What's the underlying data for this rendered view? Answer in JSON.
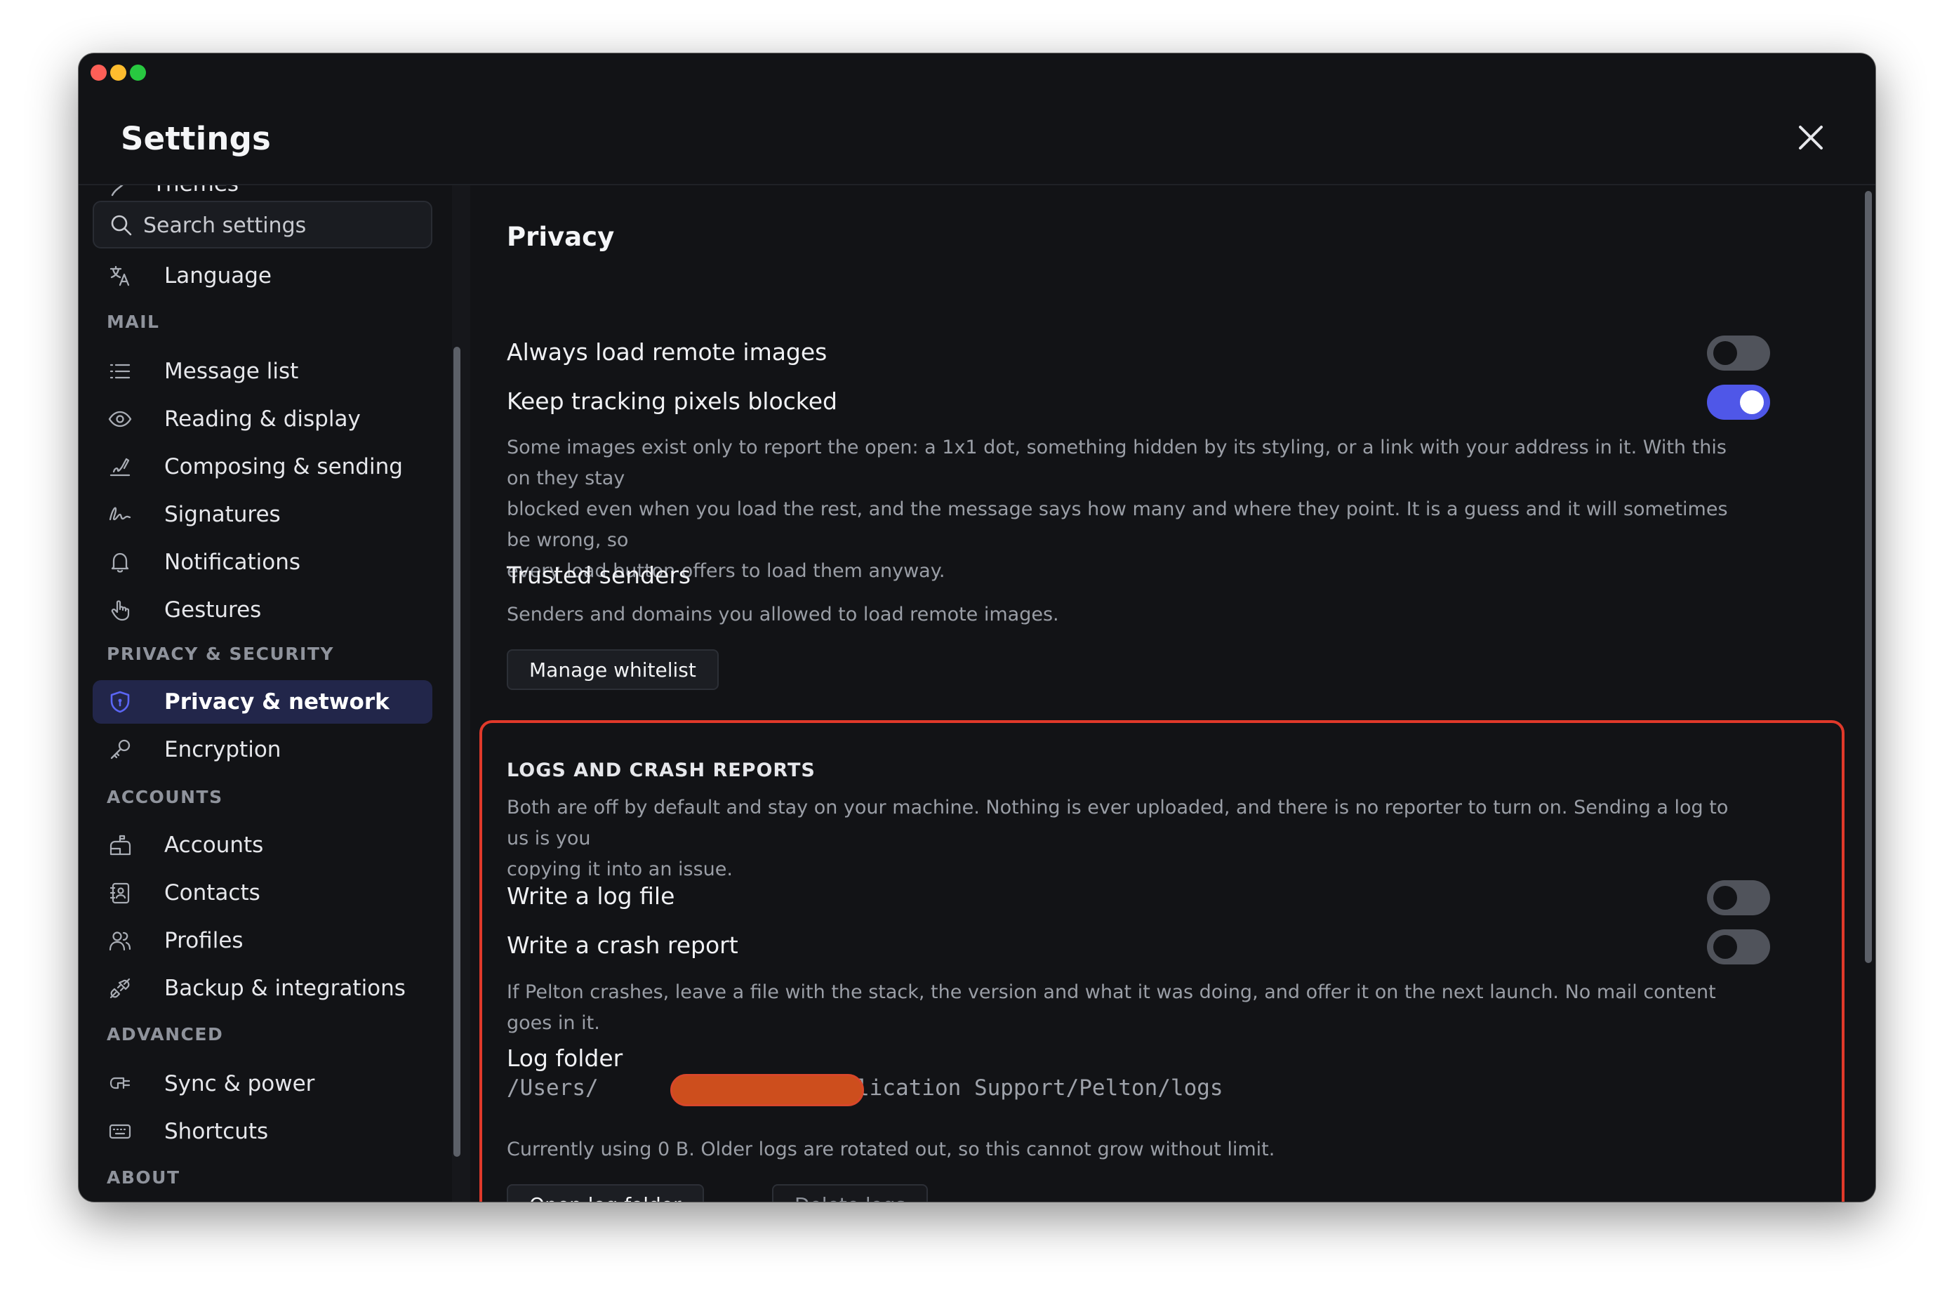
{
  "window": {
    "title": "Settings",
    "close_icon": "close-icon"
  },
  "sidebar": {
    "clipped_item": "Themes",
    "search": {
      "placeholder": "Search settings",
      "value": ""
    },
    "language": "Language",
    "sections": {
      "mail": "MAIL",
      "privacy_security": "PRIVACY & SECURITY",
      "accounts": "ACCOUNTS",
      "advanced": "ADVANCED",
      "about": "ABOUT"
    },
    "items": {
      "message_list": "Message list",
      "reading_display": "Reading & display",
      "composing_sending": "Composing & sending",
      "signatures": "Signatures",
      "notifications": "Notifications",
      "gestures": "Gestures",
      "privacy_network": "Privacy & network",
      "encryption": "Encryption",
      "accounts": "Accounts",
      "contacts": "Contacts",
      "profiles": "Profiles",
      "backup_integrations": "Backup & integrations",
      "sync_power": "Sync & power",
      "shortcuts": "Shortcuts"
    },
    "active_item": "Privacy & network",
    "accent_color": "#4f57e8"
  },
  "privacy": {
    "heading": "Privacy",
    "always_load_remote_images": {
      "label": "Always load remote images",
      "enabled": false
    },
    "keep_tracking_pixels_blocked": {
      "label": "Keep tracking pixels blocked",
      "enabled": true
    },
    "tracking_description_1": "Some images exist only to report the open: a 1x1 dot, something hidden by its styling, or a link with your address in it. With this on they stay",
    "tracking_description_2": "blocked even when you load the rest, and the message says how many and where they point. It is a guess and it will sometimes be wrong, so",
    "tracking_description_3": "every load button offers to load them anyway.",
    "trusted_senders": {
      "label": "Trusted senders",
      "description": "Senders and domains you allowed to load remote images.",
      "button": "Manage whitelist"
    }
  },
  "logs": {
    "heading": "LOGS AND CRASH REPORTS",
    "description_1": "Both are off by default and stay on your machine. Nothing is ever uploaded, and there is no reporter to turn on. Sending a log to us is you",
    "description_2": "copying it into an issue.",
    "write_log_file": {
      "label": "Write a log file",
      "enabled": false
    },
    "write_crash_report": {
      "label": "Write a crash report",
      "enabled": false
    },
    "crash_description": "If Pelton crashes, leave a file with the stack, the version and what it was doing, and offer it on the next launch. No mail content goes in it.",
    "log_folder_label": "Log folder",
    "path_prefix": "/Users/",
    "path_suffix": "y/Application Support/Pelton/logs",
    "usage_text": "Currently using 0 B. Older logs are rotated out, so this cannot grow without limit.",
    "open_button": "Open log folder",
    "delete_button": "Delete logs",
    "highlight_color": "#e0392a",
    "redaction_color": "#cd4e1d"
  }
}
